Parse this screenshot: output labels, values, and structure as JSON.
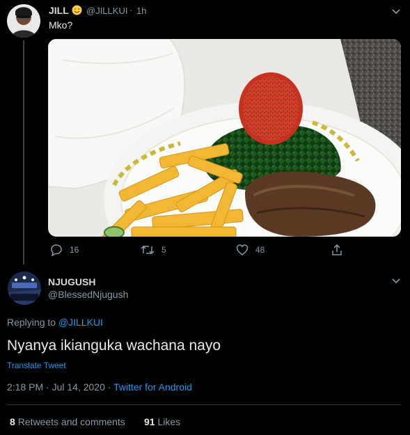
{
  "tweet1": {
    "name": "JILL",
    "emoji_icon": "smiling-face-icon",
    "handle": "@JILLKUI",
    "separator": "·",
    "time": "1h",
    "text": "Mko?",
    "photo_icon": "food-plate-photo",
    "actions": {
      "reply_count": "16",
      "retweet_count": "5",
      "like_count": "48"
    }
  },
  "tweet2": {
    "name": "NJUGUSH",
    "handle": "@BlessedNjugush",
    "replying_prefix": "Replying to",
    "replying_to": "@JILLKUI",
    "text": "Nyanya ikianguka wachana nayo",
    "translate": "Translate Tweet",
    "timestamp": "2:18 PM · Jul 14, 2020 ·",
    "source": "Twitter for Android",
    "stats": {
      "retweets_count": "8",
      "retweets_label": "Retweets and comments",
      "likes_count": "91",
      "likes_label": "Likes"
    }
  },
  "colors": {
    "background": "#000000",
    "accent": "#1d9bf0",
    "muted": "#8b98a5"
  }
}
